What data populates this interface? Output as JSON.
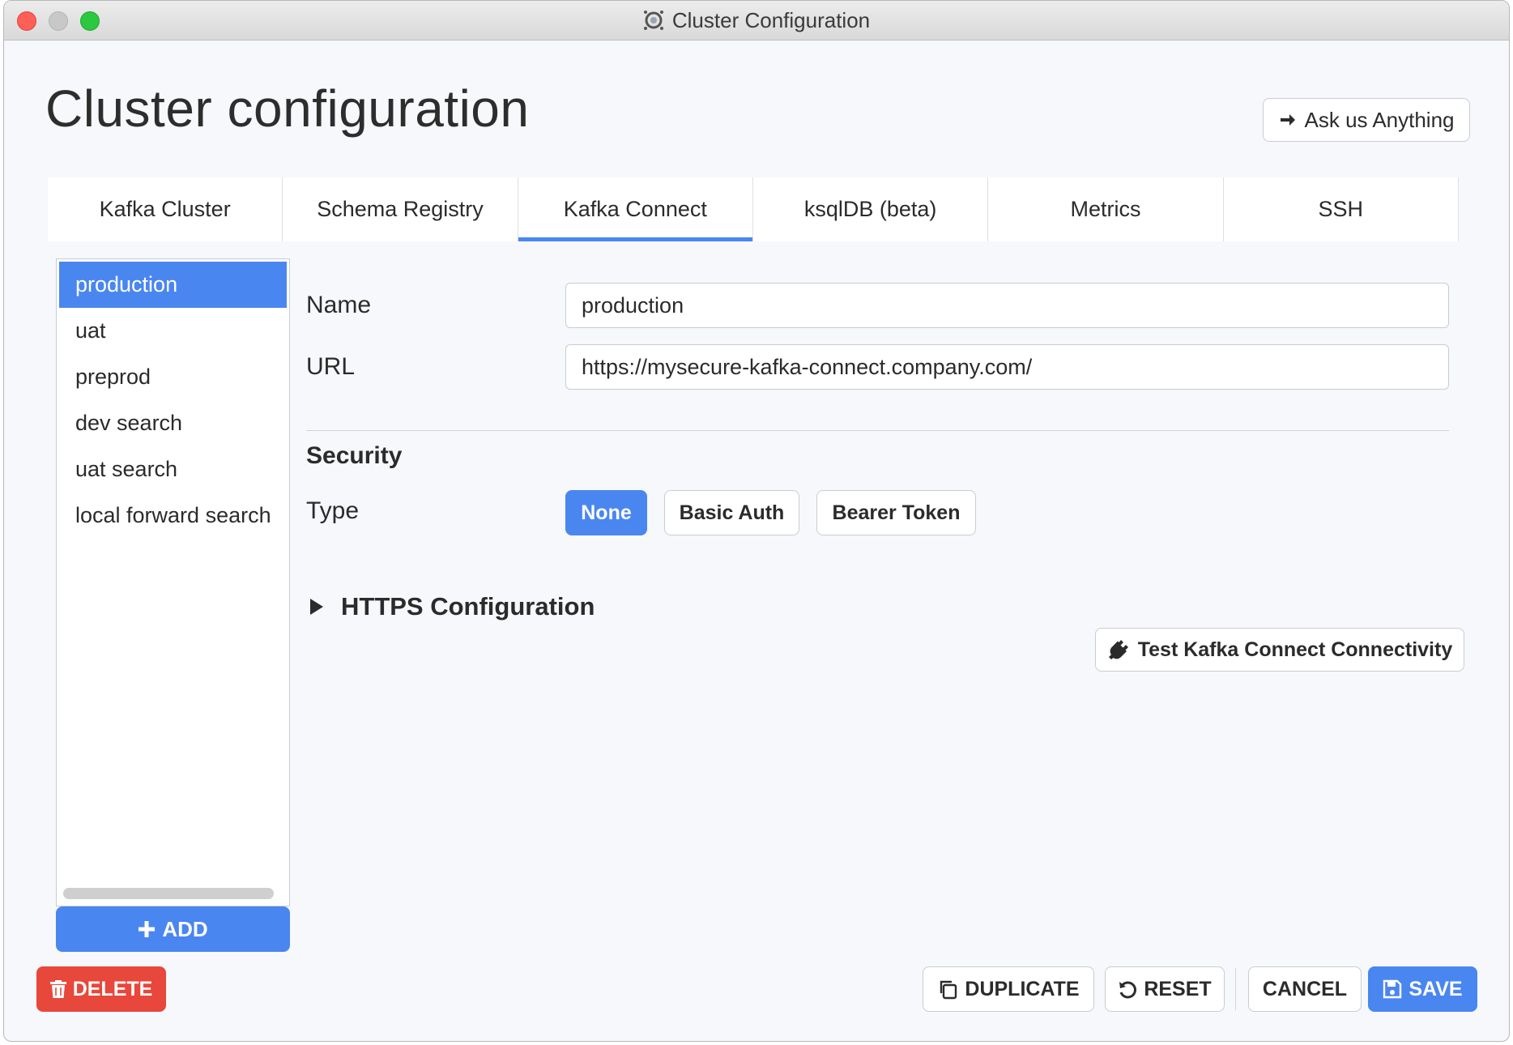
{
  "window": {
    "title": "Cluster Configuration"
  },
  "header": {
    "title": "Cluster configuration",
    "ask_label": "Ask us Anything"
  },
  "tabs": [
    {
      "label": "Kafka Cluster"
    },
    {
      "label": "Schema Registry"
    },
    {
      "label": "Kafka Connect",
      "active": true
    },
    {
      "label": "ksqlDB (beta)"
    },
    {
      "label": "Metrics"
    },
    {
      "label": "SSH"
    }
  ],
  "clusters": {
    "items": [
      {
        "label": "production",
        "selected": true
      },
      {
        "label": "uat"
      },
      {
        "label": "preprod"
      },
      {
        "label": "dev search"
      },
      {
        "label": "uat search"
      },
      {
        "label": "local forward search"
      }
    ],
    "add_label": "ADD"
  },
  "form": {
    "name_label": "Name",
    "name_value": "production",
    "url_label": "URL",
    "url_value": "https://mysecure-kafka-connect.company.com/",
    "security_title": "Security",
    "type_label": "Type",
    "security_types": [
      {
        "label": "None",
        "active": true
      },
      {
        "label": "Basic Auth"
      },
      {
        "label": "Bearer Token"
      }
    ],
    "https_label": "HTTPS Configuration",
    "test_label": "Test Kafka Connect Connectivity"
  },
  "footer": {
    "delete_label": "DELETE",
    "duplicate_label": "DUPLICATE",
    "reset_label": "RESET",
    "cancel_label": "CANCEL",
    "save_label": "SAVE"
  },
  "colors": {
    "accent": "#4a86f0",
    "danger": "#e8473b"
  }
}
